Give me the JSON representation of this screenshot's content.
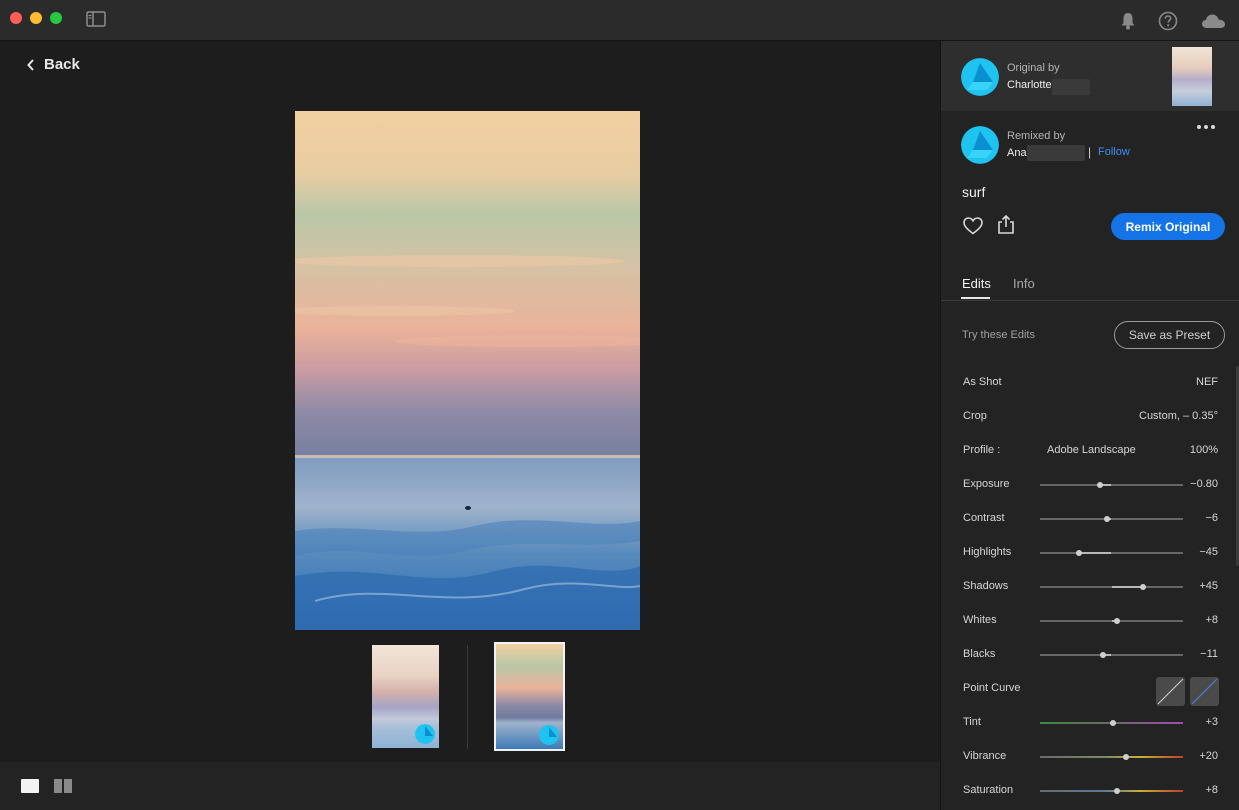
{
  "toolbar": {
    "icons": [
      "sidebar-toggle-icon",
      "bell-icon",
      "help-icon",
      "cloud-icon"
    ]
  },
  "viewer": {
    "back_label": "Back"
  },
  "original": {
    "by_label": "Original by",
    "name": "Charlotte"
  },
  "remix": {
    "by_label": "Remixed by",
    "name": "Ana",
    "separator": "|",
    "follow_label": "Follow",
    "title": "surf",
    "remix_button": "Remix Original"
  },
  "tabs": [
    {
      "label": "Edits",
      "active": true
    },
    {
      "label": "Info",
      "active": false
    }
  ],
  "edits": {
    "try_label": "Try these Edits",
    "save_preset": "Save as Preset",
    "rows": {
      "as_shot": {
        "label": "As Shot",
        "value": "NEF"
      },
      "crop": {
        "label": "Crop",
        "value": "Custom, – 0.35°"
      },
      "profile": {
        "label": "Profile :",
        "name": "Adobe Landscape",
        "value": "100%"
      },
      "exposure": {
        "label": "Exposure",
        "value": "−0.80",
        "position": 0.42
      },
      "contrast": {
        "label": "Contrast",
        "value": "−6",
        "position": 0.47
      },
      "highlights": {
        "label": "Highlights",
        "value": "−45",
        "position": 0.27
      },
      "shadows": {
        "label": "Shadows",
        "value": "+45",
        "position": 0.72
      },
      "whites": {
        "label": "Whites",
        "value": "+8",
        "position": 0.54
      },
      "blacks": {
        "label": "Blacks",
        "value": "−11",
        "position": 0.44
      },
      "point_curve": {
        "label": "Point Curve"
      },
      "tint": {
        "label": "Tint",
        "value": "+3",
        "position": 0.51
      },
      "vibrance": {
        "label": "Vibrance",
        "value": "+20",
        "position": 0.6
      },
      "saturation": {
        "label": "Saturation",
        "value": "+8",
        "position": 0.54
      }
    }
  },
  "colors": {
    "accent": "#1473e6",
    "follow": "#3e8ff2",
    "avatar": "#1fc3ef"
  }
}
